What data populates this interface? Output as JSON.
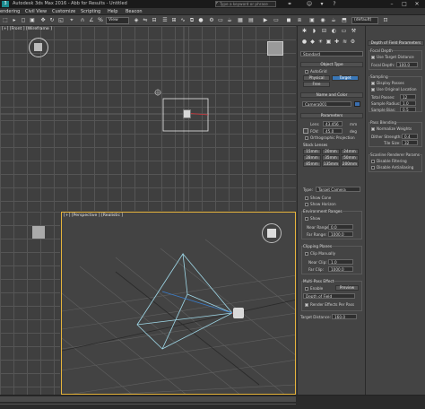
{
  "titlebar": {
    "title": "Autodesk 3ds Max 2016 - Abb for Results - Untitled",
    "keyword_placeholder": "Type a keyword or phrase",
    "minimize": "–",
    "maximize": "□",
    "close": "✕"
  },
  "menubar": {
    "items": [
      "endering",
      "Civil View",
      "Customize",
      "Scripting",
      "Help",
      "Beacon"
    ]
  },
  "toolbar": {
    "view_dropdown": "View",
    "selection_set": "(default)"
  },
  "viewports": {
    "top_label": "[+] [Front ] [Wireframe ]",
    "persp_label": "[+] [Perspective ] [Realistic ]"
  },
  "cmdpanel": {
    "name_field": "Standard",
    "object_type": "Object Type",
    "autogrid": "AutoGrid",
    "physical": "Physical",
    "target": "Target",
    "free": "Free",
    "name_and_color": "Name and Color",
    "camera_name": "Camera001",
    "parameters": "Parameters",
    "lens_label": "Lens",
    "lens_value": "43.456",
    "lens_unit": "mm",
    "fov_label": "FOV:",
    "fov_value": "45.0",
    "fov_unit": "deg",
    "ortho": "Orthographic Projection",
    "stock_lenses": "Stock Lenses",
    "lenses": [
      "15mm",
      "20mm",
      "24mm",
      "28mm",
      "35mm",
      "50mm",
      "85mm",
      "135mm",
      "200mm"
    ],
    "type_label": "Type:",
    "type_value": "Target Camera",
    "show_cone": "Show Cone",
    "show_horizon": "Show Horizon",
    "env_ranges": "Environment Ranges",
    "show": "Show",
    "near_range_label": "Near Range:",
    "near_range": "0.0",
    "far_range_label": "Far Range:",
    "far_range": "1000.0",
    "clipping_planes": "Clipping Planes",
    "clip_manually": "Clip Manually",
    "near_clip_label": "Near Clip:",
    "near_clip": "1.0",
    "far_clip_label": "Far Clip:",
    "far_clip": "1000.0",
    "multipass": "Multi-Pass Effect",
    "enable": "Enable",
    "preview": "Preview",
    "effect": "Depth of Field",
    "render_effects": "Render Effects Per Pass",
    "target_distance_label": "Target Distance:",
    "target_distance": "160.0"
  },
  "dof": {
    "header": "Depth of Field Parameters",
    "focal_depth": "Focal Depth",
    "use_target": "Use Target Distance",
    "focal_depth_label": "Focal Depth:",
    "focal_depth_value": "100.0",
    "sampling": "Sampling",
    "display_passes": "Display Passes",
    "use_original": "Use Original Location",
    "total_passes_label": "Total Passes:",
    "total_passes": "12",
    "sample_radius_label": "Sample Radius:",
    "sample_radius": "1.0",
    "sample_bias_label": "Sample Bias:",
    "sample_bias": "0.5",
    "pass_blending": "Pass Blending",
    "normalize": "Normalize Weights",
    "dither_label": "Dither Strength:",
    "dither": "0.4",
    "tile_label": "Tile Size:",
    "tile": "32",
    "scanline": "Scanline Renderer Params",
    "disable_filtering": "Disable Filtering",
    "disable_aa": "Disable Antialiasing"
  }
}
